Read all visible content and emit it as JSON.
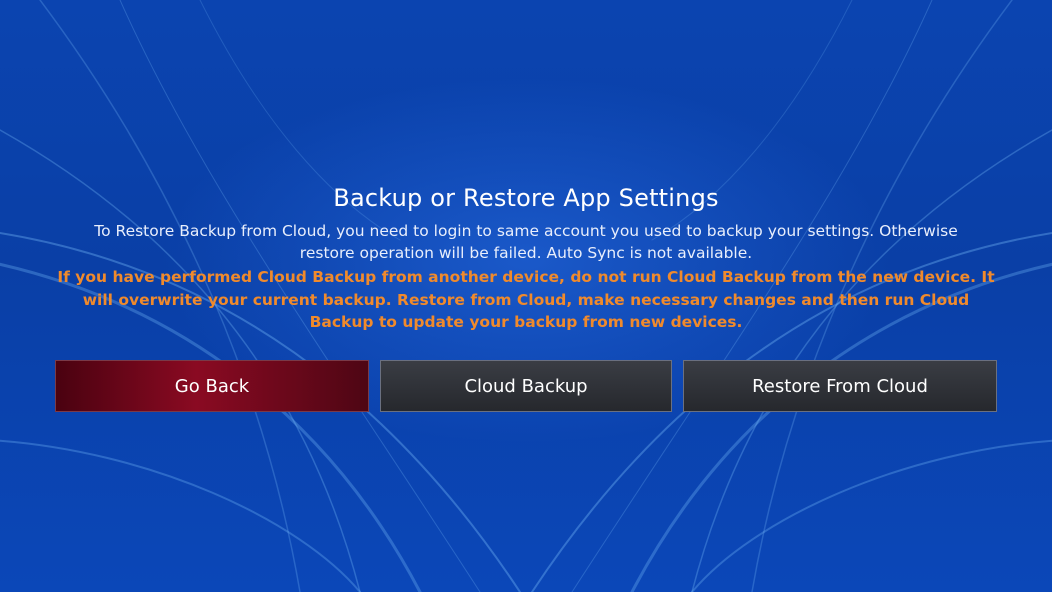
{
  "dialog": {
    "title": "Backup or Restore App Settings",
    "description": "To Restore Backup from Cloud, you need to login to same account you used to backup your settings. Otherwise restore operation will be failed.  Auto Sync is not available.",
    "warning": "If you have performed Cloud Backup from another device, do not run Cloud Backup from the new device. It will overwrite your current backup. Restore from Cloud, make necessary changes and then run Cloud Backup to update your backup from new devices."
  },
  "buttons": {
    "go_back": "Go Back",
    "cloud_backup": "Cloud Backup",
    "restore_from_cloud": "Restore From Cloud"
  },
  "colors": {
    "background": "#0a3fa6",
    "warning_text": "#f08a2c",
    "go_back_button": "#8a0a22",
    "secondary_button": "#2e3036"
  }
}
